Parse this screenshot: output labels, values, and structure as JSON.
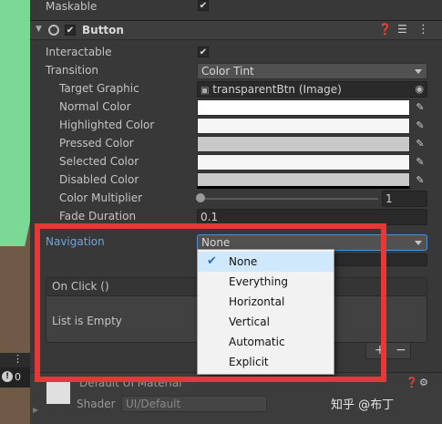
{
  "maskable": {
    "label": "Maskable",
    "checked": true
  },
  "component": {
    "title": "Button",
    "enabled": true,
    "icons": [
      "help-icon",
      "settings-icon",
      "more-icon"
    ]
  },
  "fields": {
    "interactable": {
      "label": "Interactable",
      "checked": true
    },
    "transition": {
      "label": "Transition",
      "value": "Color Tint"
    },
    "target_graphic": {
      "label": "Target Graphic",
      "value": "transparentBtn (Image)"
    },
    "normal_color": {
      "label": "Normal Color",
      "color": "#ffffff"
    },
    "highlighted_color": {
      "label": "Highlighted Color",
      "color": "#f5f5f5"
    },
    "pressed_color": {
      "label": "Pressed Color",
      "color": "#c8c8c8"
    },
    "selected_color": {
      "label": "Selected Color",
      "color": "#f5f5f5"
    },
    "disabled_color": {
      "label": "Disabled Color",
      "color": "#c8c8c8"
    },
    "color_multiplier": {
      "label": "Color Multiplier",
      "value": "1"
    },
    "fade_duration": {
      "label": "Fade Duration",
      "value": "0.1"
    },
    "navigation": {
      "label": "Navigation",
      "value": "None"
    }
  },
  "navigation_menu": {
    "options": [
      "None",
      "Everything",
      "Horizontal",
      "Vertical",
      "Automatic",
      "Explicit"
    ],
    "selected": "None"
  },
  "on_click": {
    "header": "On Click ()",
    "empty_text": "List is Empty",
    "add_label": "+",
    "remove_label": "−"
  },
  "material": {
    "name": "Default UI Material",
    "shader_label": "Shader",
    "shader_value": "UI/Default"
  },
  "scene": {
    "counter": "0"
  },
  "watermark": "知乎 @布丁",
  "colors": {
    "highlight": "#e53935",
    "accent": "#4d8fd6"
  }
}
